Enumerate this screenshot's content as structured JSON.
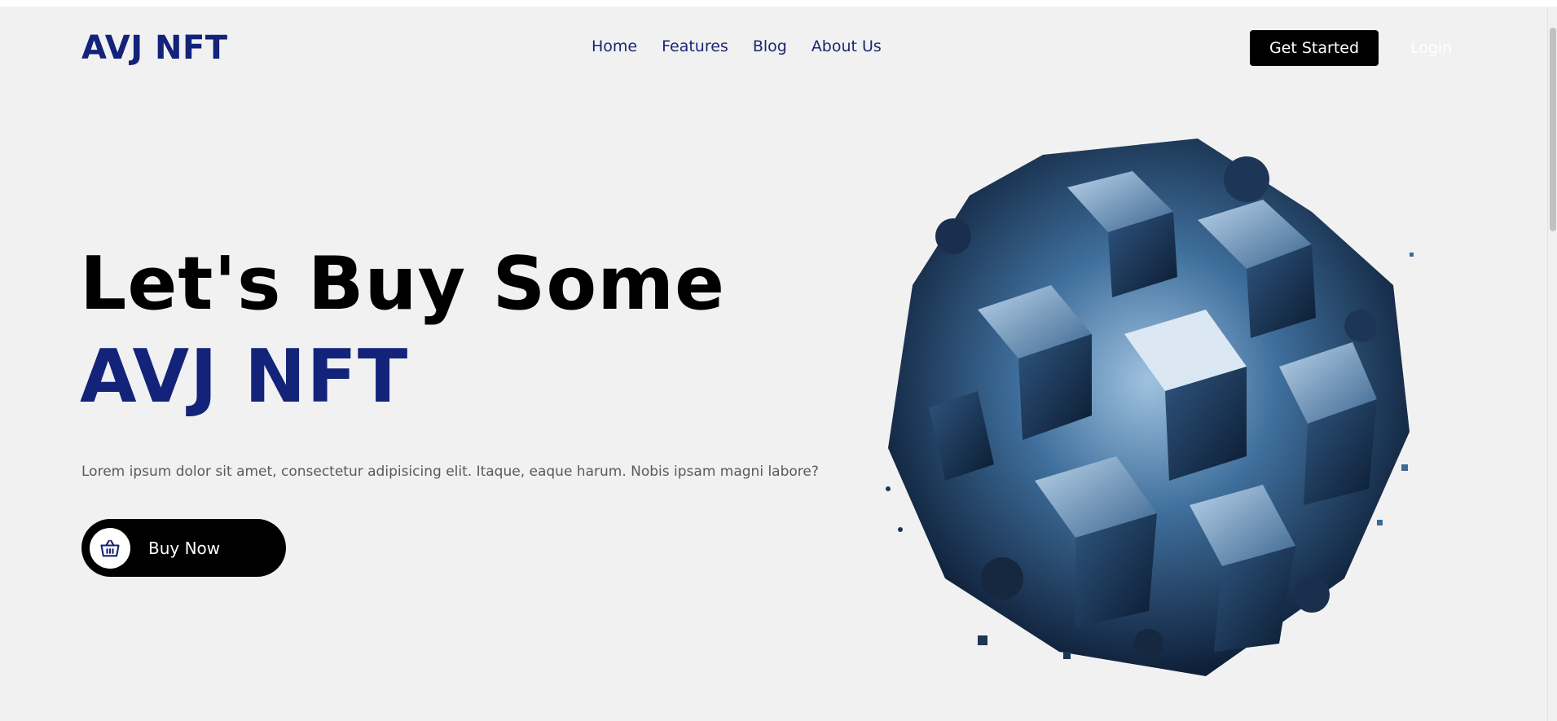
{
  "header": {
    "logo": "AVJ NFT",
    "nav": [
      "Home",
      "Features",
      "Blog",
      "About Us"
    ],
    "get_started_label": "Get Started",
    "login_label": "Login"
  },
  "hero": {
    "title_line1": "Let's Buy Some",
    "title_line2": "AVJ NFT",
    "description": "Lorem ipsum dolor sit amet, consectetur adipisicing elit. Itaque, eaque harum. Nobis ipsam magni labore?",
    "buy_label": "Buy Now",
    "buy_icon": "basket-icon"
  },
  "art": {
    "name": "nft-cube-sphere-artwork"
  },
  "colors": {
    "brand": "#13237a",
    "background": "#f2f1f2",
    "button": "#000000"
  }
}
